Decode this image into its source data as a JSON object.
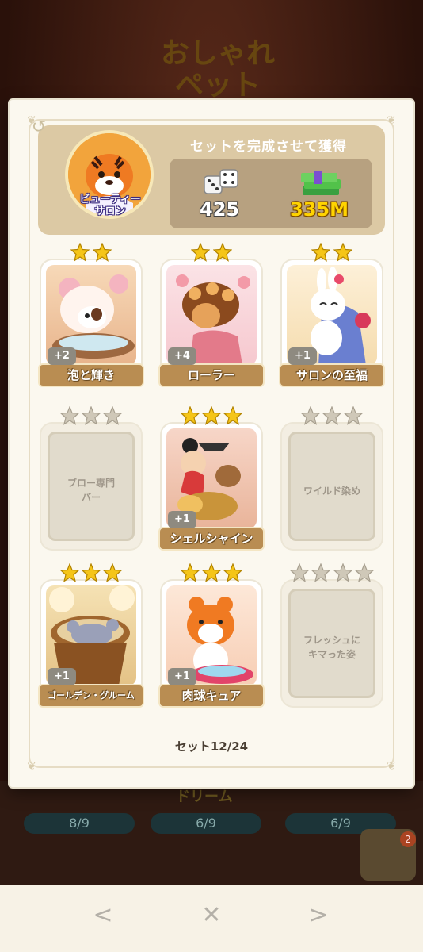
{
  "background": {
    "title_line1": "おしゃれ",
    "title_line2": "ペット",
    "bottom_labels": [
      "ドリーム"
    ],
    "progress": [
      "8/9",
      "6/9",
      "6/9"
    ],
    "notification_count": "2"
  },
  "header": {
    "set_name_line1": "ビューティー",
    "set_name_line2": "サロン",
    "reward_title": "セットを完成させて獲得",
    "dice_reward": "425",
    "cash_reward": "335M"
  },
  "cards": [
    {
      "name": "泡と輝き",
      "stars": 2,
      "count": "+2",
      "owned": true
    },
    {
      "name": "ローラー",
      "stars": 2,
      "count": "+4",
      "owned": true
    },
    {
      "name": "サロンの至福",
      "stars": 2,
      "count": "+1",
      "owned": true
    },
    {
      "name": "ブロー専門バー",
      "name_line1": "ブロー専門",
      "name_line2": "バー",
      "stars": 3,
      "owned": false
    },
    {
      "name": "シェルシャイン",
      "stars": 3,
      "count": "+1",
      "owned": true
    },
    {
      "name": "ワイルド染め",
      "stars": 3,
      "owned": false
    },
    {
      "name": "ゴールデン・グルーム",
      "stars": 3,
      "count": "+1",
      "owned": true
    },
    {
      "name": "肉球キュア",
      "stars": 3,
      "count": "+1",
      "owned": true
    },
    {
      "name": "フレッシュにキマった姿",
      "name_line1": "フレッシュに",
      "name_line2": "キマった姿",
      "stars": 4,
      "owned": false
    }
  ],
  "footer": {
    "set_progress": "セット12/24"
  },
  "nav": {
    "prev": "<",
    "close": "✕",
    "next": ">"
  },
  "colors": {
    "accent_label": "#b98d52",
    "star_gold": "#f5c518",
    "star_empty": "#cfc8b8",
    "header_bg": "#dcc9a4"
  }
}
